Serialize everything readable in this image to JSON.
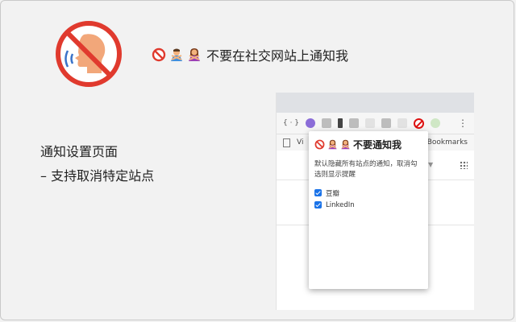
{
  "headline": {
    "emojis": [
      "prohibited-icon",
      "person-gesturing-no-man-icon",
      "person-gesturing-no-woman-icon"
    ],
    "text": "不要在社交网站上通知我"
  },
  "description": {
    "line1": "通知设置页面",
    "line2": "– 支持取消特定站点"
  },
  "browser": {
    "toolbar_text": "{ · }",
    "bookmarks": {
      "left": "Vi",
      "right": "r Bookmarks"
    }
  },
  "popup": {
    "title": "不要通知我",
    "description": "默认隐藏所有站点的通知，取消勾选则显示提醒",
    "sites": [
      {
        "label": "豆瓣",
        "checked": true
      },
      {
        "label": "LinkedIn",
        "checked": true
      }
    ]
  },
  "colors": {
    "accent_red": "#e03a2e",
    "face": "#f2a77a",
    "checkbox": "#1a73e8"
  }
}
